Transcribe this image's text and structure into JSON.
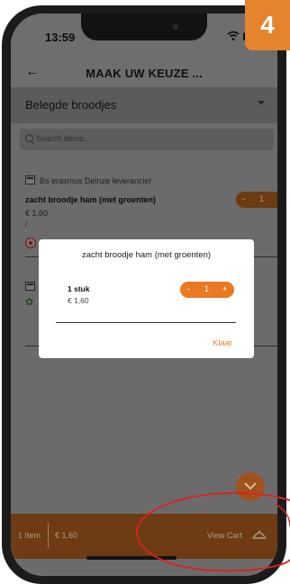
{
  "status_bar": {
    "time": "13:59"
  },
  "header": {
    "back_icon": "back-arrow-icon",
    "title": "MAAK UW KEUZE ..."
  },
  "category": {
    "selected": "Belegde broodjes"
  },
  "search": {
    "placeholder": "Search items..."
  },
  "products": [
    {
      "store": "Bs erasmus Deinze leverancier",
      "name": "zacht broodje ham (met groenten)",
      "price": "€ 1,60",
      "sub": "/",
      "stepper": {
        "minus": "-",
        "qty": "1",
        "plus": "+"
      }
    }
  ],
  "modal": {
    "title": "zacht broodje ham (met groenten)",
    "qty_label": "1 stuk",
    "price": "€ 1,60",
    "stepper": {
      "minus": "-",
      "qty": "1",
      "plus": "+"
    },
    "done_label": "Klaar"
  },
  "cart": {
    "count": "1 Item",
    "total": "€ 1,60",
    "view_label": "View Cart"
  },
  "step_badge": "4",
  "colors": {
    "accent": "#ea7a21",
    "annotation": "#e02020"
  }
}
